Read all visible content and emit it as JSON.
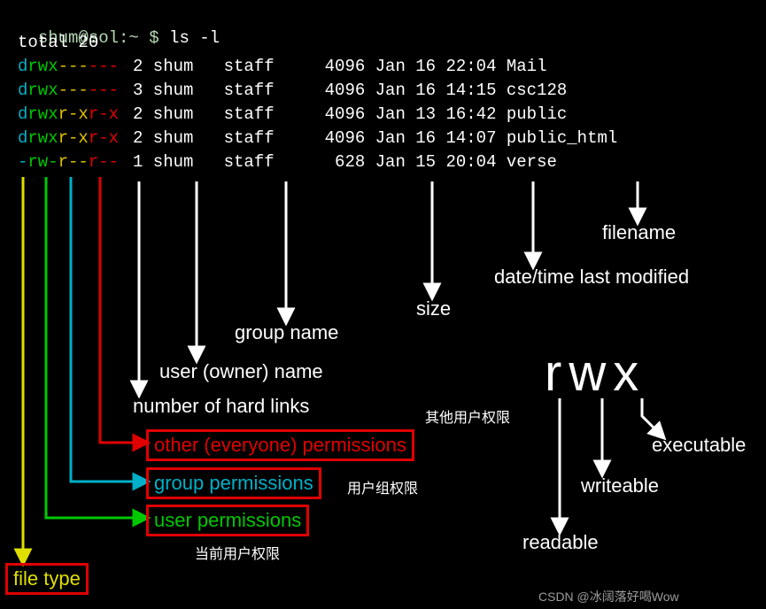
{
  "prompt": "shum@sol:~ $",
  "command": "ls -l",
  "total_line": "total 20",
  "rows": [
    {
      "type": "d",
      "u": "rwx",
      "g": "---",
      "o": "---",
      "links": "2",
      "owner": "shum",
      "group": "staff",
      "size": "4096",
      "mon": "Jan",
      "day": "16",
      "time": "22:04",
      "name": "Mail"
    },
    {
      "type": "d",
      "u": "rwx",
      "g": "---",
      "o": "---",
      "links": "3",
      "owner": "shum",
      "group": "staff",
      "size": "4096",
      "mon": "Jan",
      "day": "16",
      "time": "14:15",
      "name": "csc128"
    },
    {
      "type": "d",
      "u": "rwx",
      "g": "r-x",
      "o": "r-x",
      "links": "2",
      "owner": "shum",
      "group": "staff",
      "size": "4096",
      "mon": "Jan",
      "day": "13",
      "time": "16:42",
      "name": "public"
    },
    {
      "type": "d",
      "u": "rwx",
      "g": "r-x",
      "o": "r-x",
      "links": "2",
      "owner": "shum",
      "group": "staff",
      "size": "4096",
      "mon": "Jan",
      "day": "16",
      "time": "14:07",
      "name": "public_html"
    },
    {
      "type": "-",
      "u": "rw-",
      "g": "r--",
      "o": "r--",
      "links": "1",
      "owner": "shum",
      "group": "staff",
      "size": "628",
      "mon": "Jan",
      "day": "15",
      "time": "20:04",
      "name": "verse"
    }
  ],
  "labels": {
    "filename": "filename",
    "datetime": "date/time last modified",
    "size": "size",
    "group": "group name",
    "owner": "user (owner) name",
    "hardlinks": "number of hard links",
    "other_perm": "other (everyone) permissions",
    "group_perm": "group permissions",
    "user_perm": "user permissions",
    "file_type": "file type",
    "cn_other": "其他用户权限",
    "cn_group": "用户组权限",
    "cn_user": "当前用户权限"
  },
  "rwx": {
    "title": "rwx",
    "r": "readable",
    "w": "writeable",
    "x": "executable"
  },
  "watermark": "CSDN @冰阔落好喝Wow"
}
